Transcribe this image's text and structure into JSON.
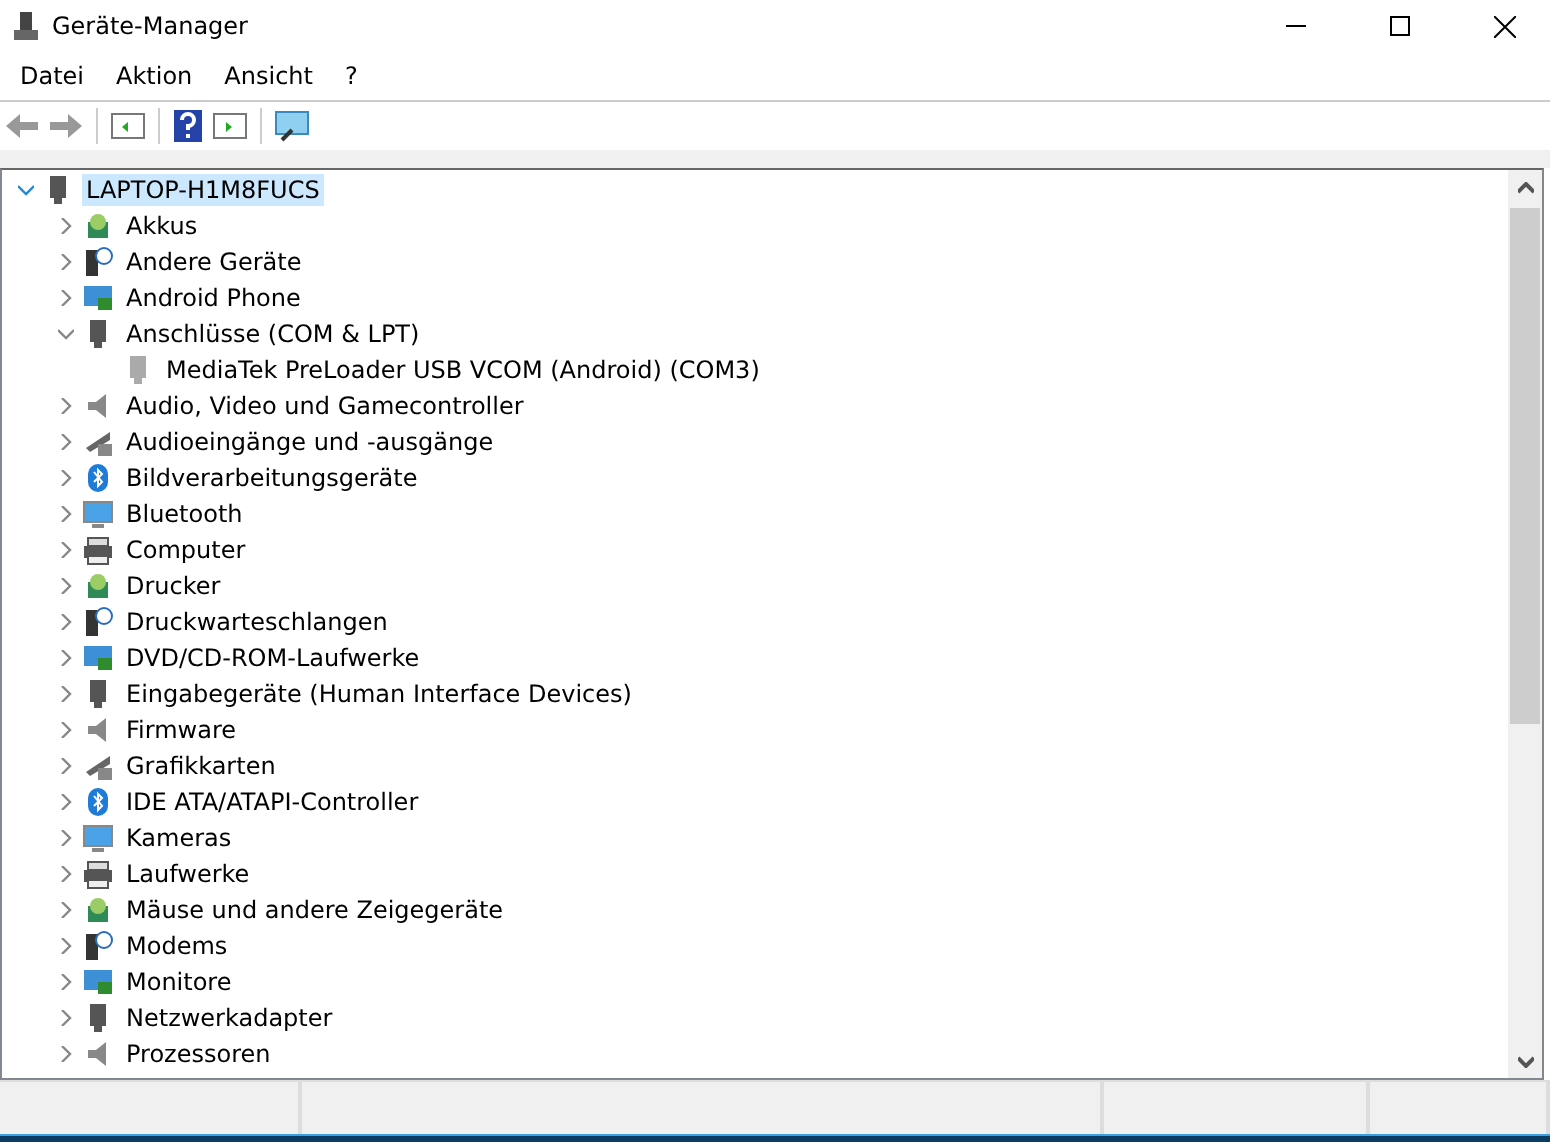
{
  "window": {
    "title": "Geräte-Manager"
  },
  "menu": [
    "Datei",
    "Aktion",
    "Ansicht",
    "?"
  ],
  "tree": [
    {
      "label": "LAPTOP-H1M8FUCS",
      "expanded": true,
      "selected": true,
      "children": [
        {
          "label": "Akkus",
          "expanded": false,
          "selected": false
        },
        {
          "label": "Andere Geräte",
          "expanded": false,
          "selected": false
        },
        {
          "label": "Android Phone",
          "expanded": false,
          "selected": false
        },
        {
          "label": "Anschlüsse (COM & LPT)",
          "expanded": true,
          "selected": false,
          "children": [
            {
              "label": "MediaTek PreLoader USB VCOM (Android) (COM3)",
              "selected": false
            }
          ]
        },
        {
          "label": "Audio, Video und Gamecontroller",
          "expanded": false,
          "selected": false
        },
        {
          "label": "Audioeingänge und -ausgänge",
          "expanded": false,
          "selected": false
        },
        {
          "label": "Bildverarbeitungsgeräte",
          "expanded": false,
          "selected": false
        },
        {
          "label": "Bluetooth",
          "expanded": false,
          "selected": false
        },
        {
          "label": "Computer",
          "expanded": false,
          "selected": false
        },
        {
          "label": "Drucker",
          "expanded": false,
          "selected": false
        },
        {
          "label": "Druckwarteschlangen",
          "expanded": false,
          "selected": false
        },
        {
          "label": "DVD/CD-ROM-Laufwerke",
          "expanded": false,
          "selected": false
        },
        {
          "label": "Eingabegeräte (Human Interface Devices)",
          "expanded": false,
          "selected": false
        },
        {
          "label": "Firmware",
          "expanded": false,
          "selected": false
        },
        {
          "label": "Grafikkarten",
          "expanded": false,
          "selected": false
        },
        {
          "label": "IDE ATA/ATAPI-Controller",
          "expanded": false,
          "selected": false
        },
        {
          "label": "Kameras",
          "expanded": false,
          "selected": false
        },
        {
          "label": "Laufwerke",
          "expanded": false,
          "selected": false
        },
        {
          "label": "Mäuse und andere Zeigegeräte",
          "expanded": false,
          "selected": false
        },
        {
          "label": "Modems",
          "expanded": false,
          "selected": false
        },
        {
          "label": "Monitore",
          "expanded": false,
          "selected": false
        },
        {
          "label": "Netzwerkadapter",
          "expanded": false,
          "selected": false
        },
        {
          "label": "Prozessoren",
          "expanded": false,
          "selected": false
        }
      ]
    }
  ]
}
